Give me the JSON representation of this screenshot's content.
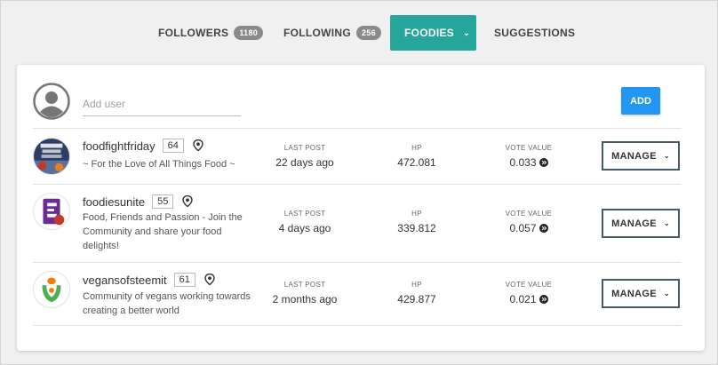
{
  "tabs": [
    {
      "label": "FOLLOWERS",
      "count": "1180"
    },
    {
      "label": "FOLLOWING",
      "count": "256"
    },
    {
      "label": "FOODIES",
      "chevron": "⌄"
    },
    {
      "label": "SUGGESTIONS"
    }
  ],
  "add_user": {
    "placeholder": "Add user",
    "button_label": "ADD"
  },
  "stat_labels": {
    "last_post": "LAST POST",
    "hp": "HP",
    "vote_value": "VOTE VALUE"
  },
  "rows": [
    {
      "name": "foodfightfriday",
      "rep": "64",
      "description": "~ For the Love of All Things Food ~",
      "last_post": "22 days ago",
      "hp": "472.081",
      "vote_value": "0.033",
      "manage_label": "MANAGE"
    },
    {
      "name": "foodiesunite",
      "rep": "55",
      "description": "Food, Friends and Passion - Join the Community and share your food delights!",
      "last_post": "4 days ago",
      "hp": "339.812",
      "vote_value": "0.057",
      "manage_label": "MANAGE"
    },
    {
      "name": "vegansofsteemit",
      "rep": "61",
      "description": "Community of vegans working towards creating a better world",
      "last_post": "2 months ago",
      "hp": "429.877",
      "vote_value": "0.021",
      "manage_label": "MANAGE"
    }
  ],
  "colors": {
    "active_tab": "#26a69a",
    "add_button": "#2196f3",
    "manage_border": "#455a64"
  }
}
